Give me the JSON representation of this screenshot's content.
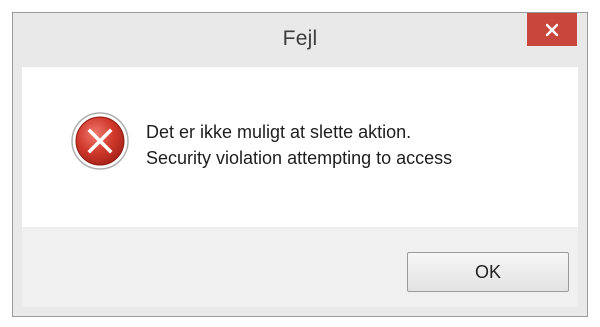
{
  "window": {
    "title": "Fejl"
  },
  "message": {
    "line1": "Det er ikke muligt at slette aktion.",
    "line2": "Security violation attempting to access"
  },
  "buttons": {
    "ok_label": "OK"
  },
  "icons": {
    "close": "close-icon",
    "error": "error-icon"
  },
  "colors": {
    "close_button": "#c9463d",
    "error_icon": "#c0392b",
    "window_frame": "#e9e9e9",
    "footer": "#f0f0f0"
  }
}
